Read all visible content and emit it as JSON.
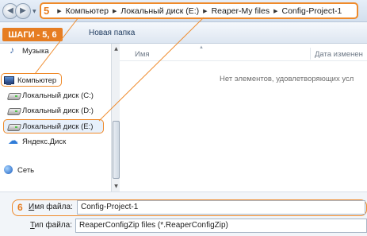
{
  "address_bar": {
    "step_label": "5",
    "path": [
      "Компьютер",
      "Локальный диск (E:)",
      "Reaper-My files",
      "Config-Project-1"
    ]
  },
  "toolbar": {
    "steps_badge": "ШАГИ - 5, 6",
    "new_folder_label": "Новая папка"
  },
  "nav_pane": {
    "items": [
      {
        "label": "Музыка",
        "icon": "music-icon"
      },
      {
        "label": "Компьютер",
        "icon": "computer-icon"
      },
      {
        "label": "Локальный диск (C:)",
        "icon": "disk-icon"
      },
      {
        "label": "Локальный диск (D:)",
        "icon": "disk-icon"
      },
      {
        "label": "Локальный диск (E:)",
        "icon": "disk-icon"
      },
      {
        "label": "Яндекс.Диск",
        "icon": "cloud-icon"
      },
      {
        "label": "Сеть",
        "icon": "network-icon"
      }
    ]
  },
  "file_list": {
    "columns": {
      "name": "Имя",
      "date": "Дата изменен"
    },
    "empty_message": "Нет элементов, удовлетворяющих усл"
  },
  "form": {
    "step_label": "6",
    "file_name_label_underlined": "И",
    "file_name_label_rest": "мя файла:",
    "file_name_value": "Config-Project-1",
    "file_type_label_underlined": "Т",
    "file_type_label_rest": "ип файла:",
    "file_type_value": "ReaperConfigZip files (*.ReaperConfigZip)"
  },
  "colors": {
    "annotation_orange": "#ef8a2a",
    "badge_orange": "#e67d22"
  }
}
